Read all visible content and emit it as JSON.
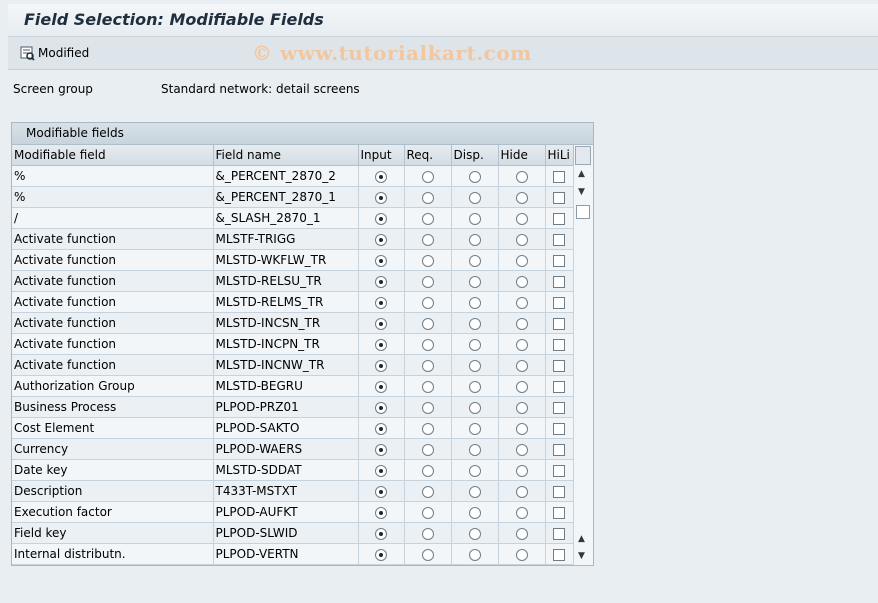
{
  "title": "Field Selection: Modifiable Fields",
  "toolbar": {
    "modified_label": "Modified"
  },
  "watermark": "© www.tutorialkart.com",
  "screen_group": {
    "label": "Screen group",
    "value": "Standard network: detail screens"
  },
  "panel": {
    "title": "Modifiable fields",
    "columns": [
      "Modifiable field",
      "Field name",
      "Input",
      "Req.",
      "Disp.",
      "Hide",
      "HiLi"
    ],
    "rows": [
      {
        "field": "%",
        "name": "&_PERCENT_2870_2",
        "sel": "Input",
        "hili": false
      },
      {
        "field": "%",
        "name": "&_PERCENT_2870_1",
        "sel": "Input",
        "hili": false
      },
      {
        "field": "/",
        "name": "&_SLASH_2870_1",
        "sel": "Input",
        "hili": false
      },
      {
        "field": "Activate function",
        "name": "MLSTF-TRIGG",
        "sel": "Input",
        "hili": false
      },
      {
        "field": "Activate function",
        "name": "MLSTD-WKFLW_TR",
        "sel": "Input",
        "hili": false
      },
      {
        "field": "Activate function",
        "name": "MLSTD-RELSU_TR",
        "sel": "Input",
        "hili": false
      },
      {
        "field": "Activate function",
        "name": "MLSTD-RELMS_TR",
        "sel": "Input",
        "hili": false
      },
      {
        "field": "Activate function",
        "name": "MLSTD-INCSN_TR",
        "sel": "Input",
        "hili": false
      },
      {
        "field": "Activate function",
        "name": "MLSTD-INCPN_TR",
        "sel": "Input",
        "hili": false
      },
      {
        "field": "Activate function",
        "name": "MLSTD-INCNW_TR",
        "sel": "Input",
        "hili": false
      },
      {
        "field": "Authorization Group",
        "name": "MLSTD-BEGRU",
        "sel": "Input",
        "hili": false
      },
      {
        "field": "Business Process",
        "name": "PLPOD-PRZ01",
        "sel": "Input",
        "hili": false
      },
      {
        "field": "Cost Element",
        "name": "PLPOD-SAKTO",
        "sel": "Input",
        "hili": false
      },
      {
        "field": "Currency",
        "name": "PLPOD-WAERS",
        "sel": "Input",
        "hili": false
      },
      {
        "field": "Date key",
        "name": "MLSTD-SDDAT",
        "sel": "Input",
        "hili": false
      },
      {
        "field": "Description",
        "name": "T433T-MSTXT",
        "sel": "Input",
        "hili": false
      },
      {
        "field": "Execution factor",
        "name": "PLPOD-AUFKT",
        "sel": "Input",
        "hili": false
      },
      {
        "field": "Field key",
        "name": "PLPOD-SLWID",
        "sel": "Input",
        "hili": false
      },
      {
        "field": "Internal distributn.",
        "name": "PLPOD-VERTN",
        "sel": "Input",
        "hili": false
      }
    ]
  }
}
